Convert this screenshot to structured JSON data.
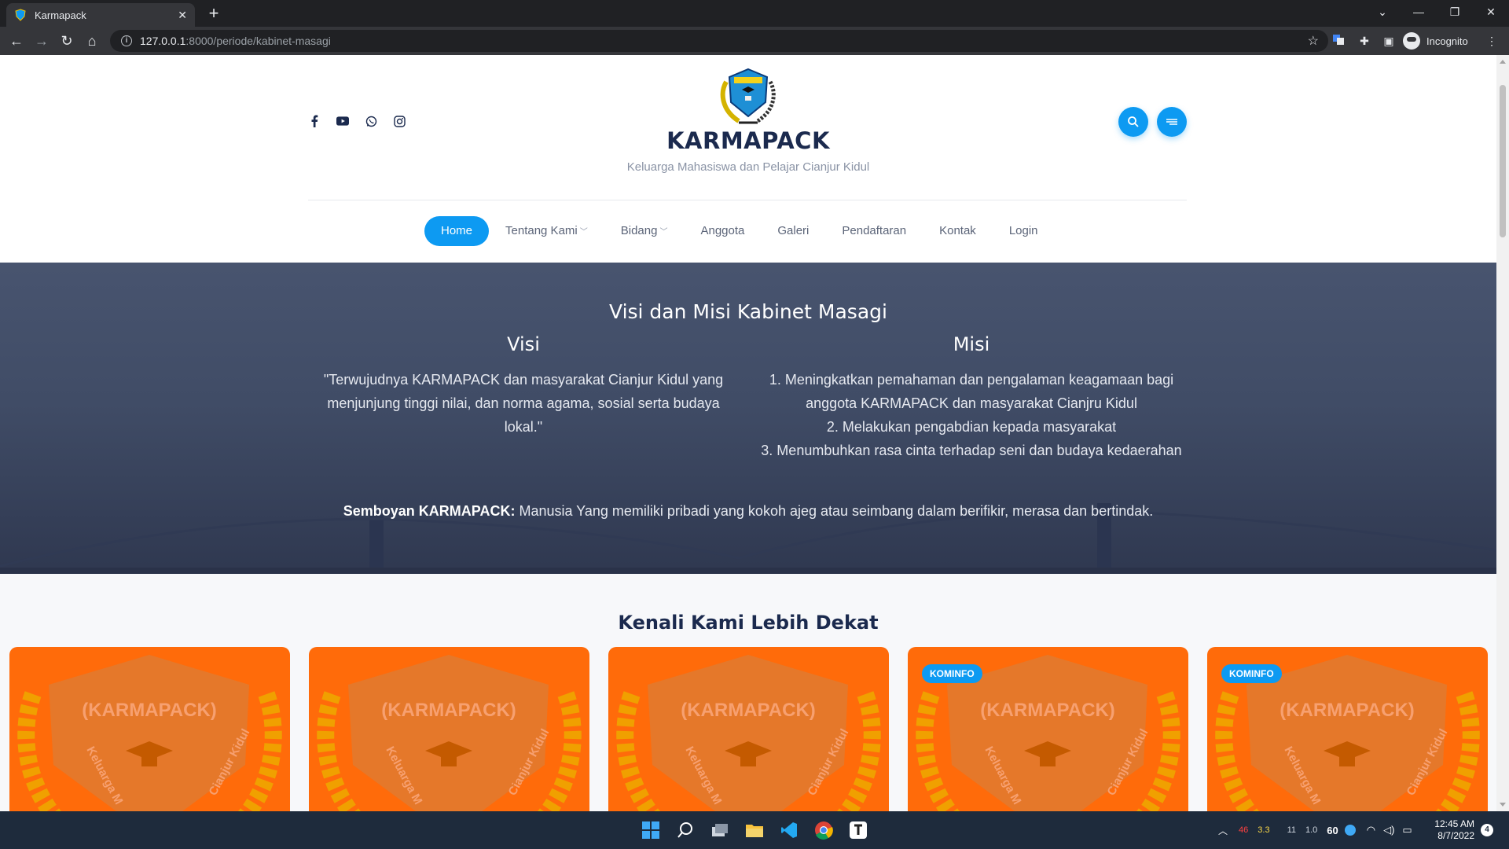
{
  "browser": {
    "tab_title": "Karmapack",
    "url_host": "127.0.0.1",
    "url_path": ":8000/periode/kabinet-masagi",
    "profile_label": "Incognito"
  },
  "site": {
    "brand": "KARMAPACK",
    "tagline": "Keluarga Mahasiswa dan Pelajar Cianjur Kidul",
    "social": [
      "facebook-icon",
      "youtube-icon",
      "whatsapp-icon",
      "instagram-icon"
    ],
    "accent_color": "#0d9af2",
    "nav": [
      {
        "label": "Home",
        "active": true,
        "dropdown": false
      },
      {
        "label": "Tentang Kami",
        "active": false,
        "dropdown": true
      },
      {
        "label": "Bidang",
        "active": false,
        "dropdown": true
      },
      {
        "label": "Anggota",
        "active": false,
        "dropdown": false
      },
      {
        "label": "Galeri",
        "active": false,
        "dropdown": false
      },
      {
        "label": "Pendaftaran",
        "active": false,
        "dropdown": false
      },
      {
        "label": "Kontak",
        "active": false,
        "dropdown": false
      },
      {
        "label": "Login",
        "active": false,
        "dropdown": false
      }
    ]
  },
  "hero": {
    "title": "Visi dan Misi Kabinet Masagi",
    "visi_heading": "Visi",
    "visi_text": "\"Terwujudnya KARMAPACK dan masyarakat Cianjur Kidul yang menjunjung tinggi nilai, dan norma agama, sosial serta budaya lokal.\"",
    "misi_heading": "Misi",
    "misi": [
      "1. Meningkatkan pemahaman dan pengalaman keagamaan bagi anggota KARMAPACK dan masyarakat Cianjru Kidul",
      "2. Melakukan pengabdian kepada masyarakat",
      "3. Menumbuhkan rasa cinta terhadap seni dan budaya kedaerahan"
    ],
    "semboyan_label": "Semboyan KARMAPACK:",
    "semboyan_text": " Manusia Yang memiliki pribadi yang kokoh ajeg atau seimbang dalam berifikir, merasa dan bertindak."
  },
  "section": {
    "title": "Kenali Kami Lebih Dekat",
    "cards": [
      {
        "badge": "",
        "logo_text": "(KARMAPACK)",
        "logo_sub": "Keluarga M",
        "logo_sub2": "Cianjur Kidul"
      },
      {
        "badge": "",
        "logo_text": "(KARMAPACK)",
        "logo_sub": "Keluarga M",
        "logo_sub2": "Cianjur Kidul"
      },
      {
        "badge": "",
        "logo_text": "(KARMAPACK)",
        "logo_sub": "Keluarga M",
        "logo_sub2": "Cianjur Kidul"
      },
      {
        "badge": "KOMINFO",
        "logo_text": "(KARMAPACK)",
        "logo_sub": "Keluarga M",
        "logo_sub2": "Cianjur Kidul"
      },
      {
        "badge": "KOMINFO",
        "logo_text": "(KARMAPACK)",
        "logo_sub": "Keluarga M",
        "logo_sub2": "Cianjur Kidul"
      }
    ]
  },
  "taskbar": {
    "tray_values": [
      "46",
      "3.3",
      "11",
      "1.0",
      "60"
    ],
    "time": "12:45 AM",
    "date": "8/7/2022",
    "notifications": "4"
  }
}
